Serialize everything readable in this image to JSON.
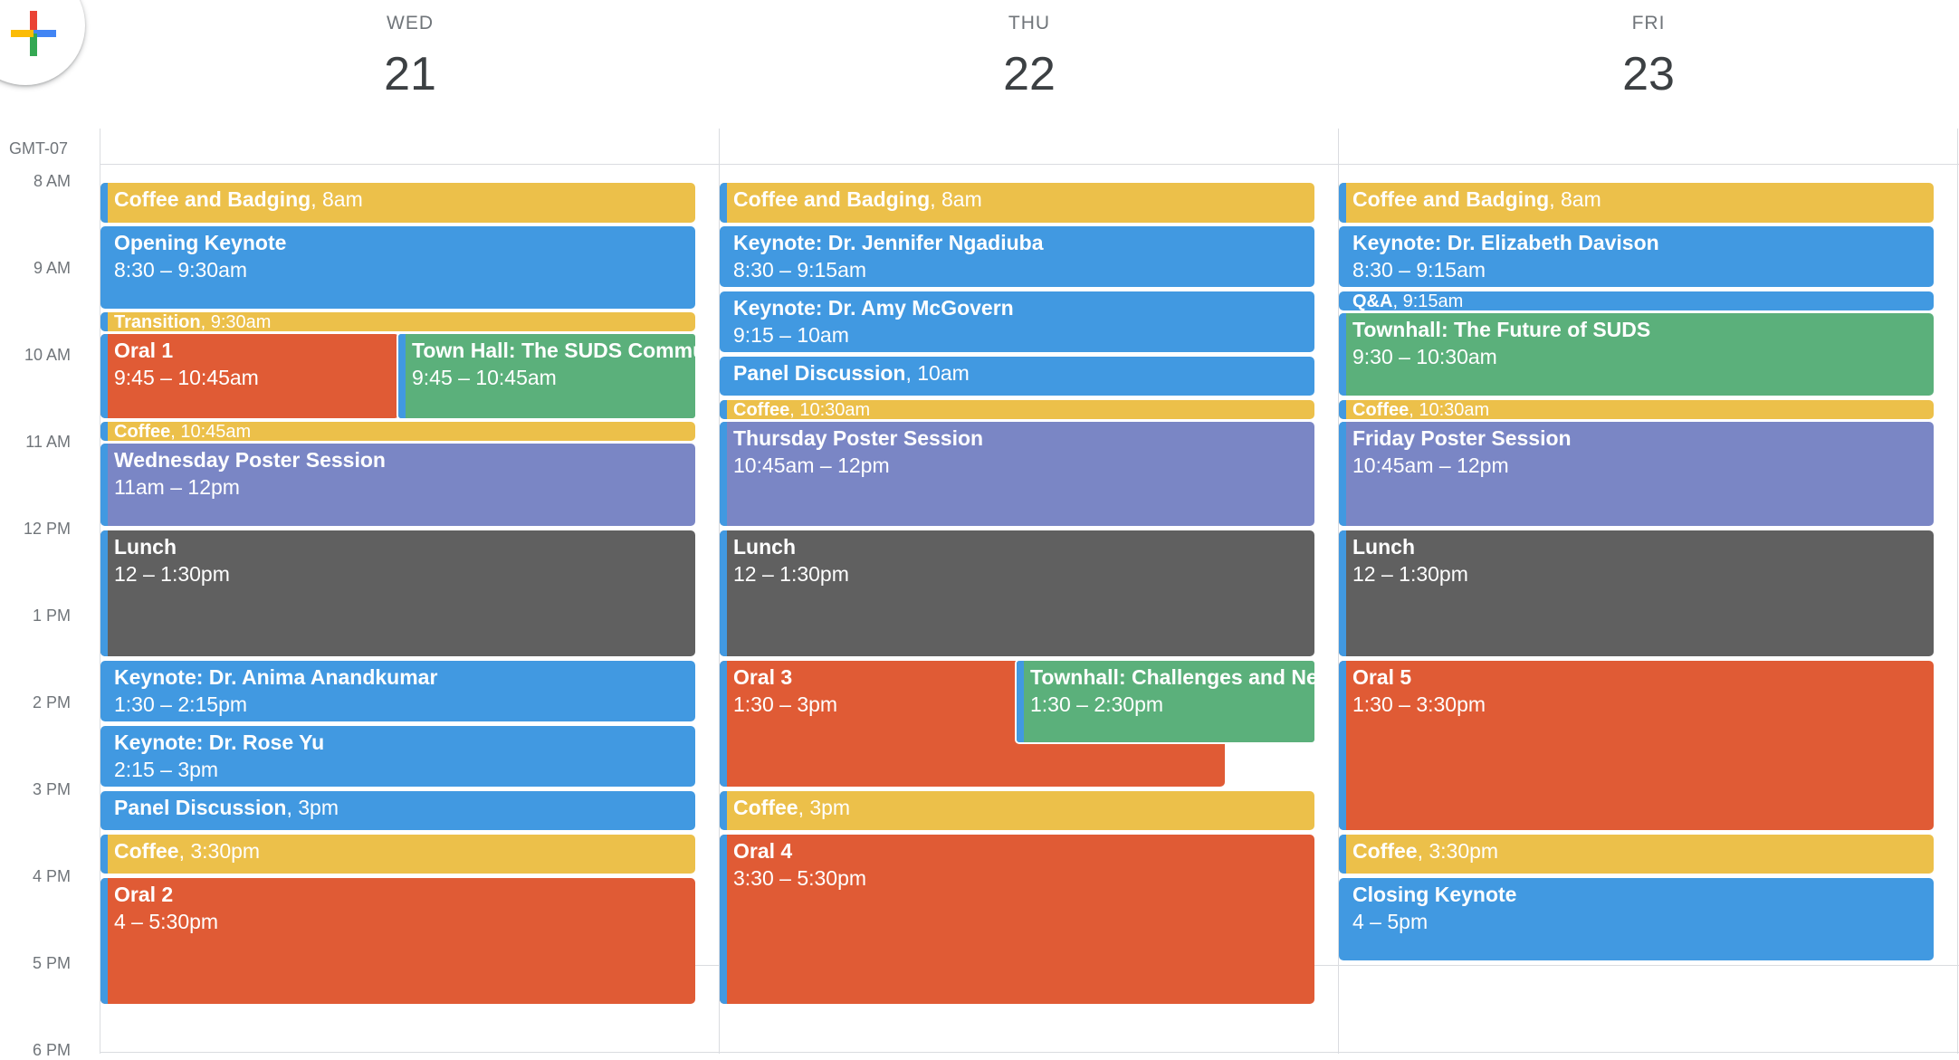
{
  "timezone": "GMT-07",
  "hours": [
    "8 AM",
    "9 AM",
    "10 AM",
    "11 AM",
    "12 PM",
    "1 PM",
    "2 PM",
    "3 PM",
    "4 PM",
    "5 PM",
    "6 PM"
  ],
  "days": [
    {
      "dow": "WED",
      "date": "21",
      "events": [
        {
          "title": "Coffee and Badging",
          "time": "8am",
          "color": "yellow",
          "inline": true
        },
        {
          "title": "Opening Keynote",
          "time": "8:30 – 9:30am",
          "color": "blue"
        },
        {
          "title": "Transition",
          "time": "9:30am",
          "color": "yellow",
          "inline": true
        },
        {
          "title": "Oral 1",
          "time": "9:45 – 10:45am",
          "color": "red"
        },
        {
          "title": "Town Hall: The SUDS Community",
          "time": "9:45 – 10:45am",
          "color": "green"
        },
        {
          "title": "Coffee",
          "time": "10:45am",
          "color": "yellow",
          "inline": true
        },
        {
          "title": "Wednesday Poster Session",
          "time": "11am – 12pm",
          "color": "purple"
        },
        {
          "title": "Lunch",
          "time": "12 – 1:30pm",
          "color": "gray"
        },
        {
          "title": "Keynote: Dr. Anima Anandkumar",
          "time": "1:30 – 2:15pm",
          "color": "blue"
        },
        {
          "title": "Keynote: Dr. Rose Yu",
          "time": "2:15 – 3pm",
          "color": "blue"
        },
        {
          "title": "Panel Discussion",
          "time": "3pm",
          "color": "blue",
          "inline": true
        },
        {
          "title": "Coffee",
          "time": "3:30pm",
          "color": "yellow",
          "inline": true
        },
        {
          "title": "Oral 2",
          "time": "4 – 5:30pm",
          "color": "red"
        }
      ]
    },
    {
      "dow": "THU",
      "date": "22",
      "events": [
        {
          "title": "Coffee and Badging",
          "time": "8am",
          "color": "yellow",
          "inline": true
        },
        {
          "title": "Keynote: Dr. Jennifer Ngadiuba",
          "time": "8:30 – 9:15am",
          "color": "blue"
        },
        {
          "title": "Keynote: Dr. Amy McGovern",
          "time": "9:15 – 10am",
          "color": "blue"
        },
        {
          "title": "Panel Discussion",
          "time": "10am",
          "color": "blue",
          "inline": true
        },
        {
          "title": "Coffee",
          "time": "10:30am",
          "color": "yellow",
          "inline": true
        },
        {
          "title": "Thursday Poster Session",
          "time": "10:45am – 12pm",
          "color": "purple"
        },
        {
          "title": "Lunch",
          "time": "12 – 1:30pm",
          "color": "gray"
        },
        {
          "title": "Oral 3",
          "time": "1:30 – 3pm",
          "color": "red"
        },
        {
          "title": "Townhall: Challenges and Next Steps",
          "time": "1:30 – 2:30pm",
          "color": "green"
        },
        {
          "title": "Coffee",
          "time": "3pm",
          "color": "yellow",
          "inline": true
        },
        {
          "title": "Oral 4",
          "time": "3:30 – 5:30pm",
          "color": "red"
        }
      ]
    },
    {
      "dow": "FRI",
      "date": "23",
      "events": [
        {
          "title": "Coffee and Badging",
          "time": "8am",
          "color": "yellow",
          "inline": true
        },
        {
          "title": "Keynote: Dr. Elizabeth Davison",
          "time": "8:30 – 9:15am",
          "color": "blue"
        },
        {
          "title": "Q&A",
          "time": "9:15am",
          "color": "blue",
          "inline": true
        },
        {
          "title": "Townhall: The Future of SUDS",
          "time": "9:30 – 10:30am",
          "color": "green"
        },
        {
          "title": "Coffee",
          "time": "10:30am",
          "color": "yellow",
          "inline": true
        },
        {
          "title": "Friday Poster Session",
          "time": "10:45am – 12pm",
          "color": "purple"
        },
        {
          "title": "Lunch",
          "time": "12 – 1:30pm",
          "color": "gray"
        },
        {
          "title": "Oral 5",
          "time": "1:30 – 3:30pm",
          "color": "red"
        },
        {
          "title": "Coffee",
          "time": "3:30pm",
          "color": "yellow",
          "inline": true
        },
        {
          "title": "Closing Keynote",
          "time": "4 – 5pm",
          "color": "blue"
        }
      ]
    }
  ]
}
